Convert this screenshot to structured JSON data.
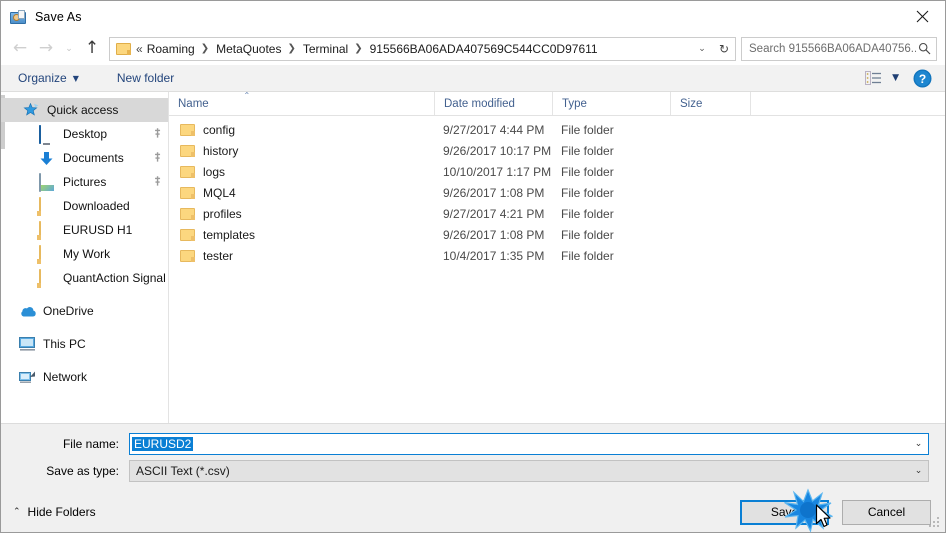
{
  "window": {
    "title": "Save As",
    "icon": "save-as-icon",
    "close_label": "✕"
  },
  "nav": {
    "back": "←",
    "forward": "→",
    "recent": "⌄",
    "up": "↑",
    "refresh": "↻",
    "dropdown": "⌄"
  },
  "address": {
    "prefix": "«",
    "crumbs": [
      "Roaming",
      "MetaQuotes",
      "Terminal",
      "915566BA06ADA407569C544CC0D97611"
    ],
    "separator": "❯"
  },
  "search": {
    "placeholder": "Search 915566BA06ADA40756...",
    "icon": "search-icon"
  },
  "toolbar": {
    "organize": "Organize",
    "new_folder": "New folder",
    "caret": "▼",
    "view_caret": "▼",
    "view_icon": "list-view-icon",
    "help_icon": "help-icon",
    "help_glyph": "?"
  },
  "sidebar": {
    "items": [
      {
        "label": "Quick access",
        "icon": "star-icon",
        "selected": true,
        "level": 1,
        "pinned": false
      },
      {
        "label": "Desktop",
        "icon": "monitor-icon",
        "selected": false,
        "level": 2,
        "pinned": true
      },
      {
        "label": "Documents",
        "icon": "download-arrow-icon",
        "selected": false,
        "level": 2,
        "pinned": true
      },
      {
        "label": "Pictures",
        "icon": "pictures-icon",
        "selected": false,
        "level": 2,
        "pinned": true
      },
      {
        "label": "Downloaded",
        "icon": "folder-icon",
        "selected": false,
        "level": 2,
        "pinned": false
      },
      {
        "label": "EURUSD H1",
        "icon": "folder-icon",
        "selected": false,
        "level": 2,
        "pinned": false
      },
      {
        "label": "My Work",
        "icon": "folder-icon",
        "selected": false,
        "level": 2,
        "pinned": false
      },
      {
        "label": "QuantAction Signal",
        "icon": "folder-icon",
        "selected": false,
        "level": 2,
        "pinned": false
      },
      {
        "label": "OneDrive",
        "icon": "onedrive-icon",
        "selected": false,
        "level": 0,
        "pinned": false
      },
      {
        "label": "This PC",
        "icon": "this-pc-icon",
        "selected": false,
        "level": 0,
        "pinned": false
      },
      {
        "label": "Network",
        "icon": "network-icon",
        "selected": false,
        "level": 0,
        "pinned": false
      }
    ],
    "pin_glyph": "📌"
  },
  "filelist": {
    "columns": [
      "Name",
      "Date modified",
      "Type",
      "Size"
    ],
    "sort_caret": "⌃",
    "rows": [
      {
        "name": "config",
        "date": "9/27/2017 4:44 PM",
        "type": "File folder",
        "size": ""
      },
      {
        "name": "history",
        "date": "9/26/2017 10:17 PM",
        "type": "File folder",
        "size": ""
      },
      {
        "name": "logs",
        "date": "10/10/2017 1:17 PM",
        "type": "File folder",
        "size": ""
      },
      {
        "name": "MQL4",
        "date": "9/26/2017 1:08 PM",
        "type": "File folder",
        "size": ""
      },
      {
        "name": "profiles",
        "date": "9/27/2017 4:21 PM",
        "type": "File folder",
        "size": ""
      },
      {
        "name": "templates",
        "date": "9/26/2017 1:08 PM",
        "type": "File folder",
        "size": ""
      },
      {
        "name": "tester",
        "date": "10/4/2017 1:35 PM",
        "type": "File folder",
        "size": ""
      }
    ]
  },
  "fields": {
    "filename_label": "File name:",
    "filename_value": "EURUSD2",
    "filetype_label": "Save as type:",
    "filetype_value": "ASCII Text (*.csv)",
    "dropdown_glyph": "⌄"
  },
  "footer": {
    "hide_folders": "Hide Folders",
    "hide_caret": "⌃",
    "save": "Save",
    "cancel": "Cancel"
  },
  "colors": {
    "accent": "#0a7fd4",
    "selection": "#0a7fd4",
    "folder": "#fcd77f",
    "link": "#23457c",
    "header_text": "#43618f",
    "toolbar_bg": "#f2f2f2",
    "footer_bg": "#f0f0f0"
  }
}
